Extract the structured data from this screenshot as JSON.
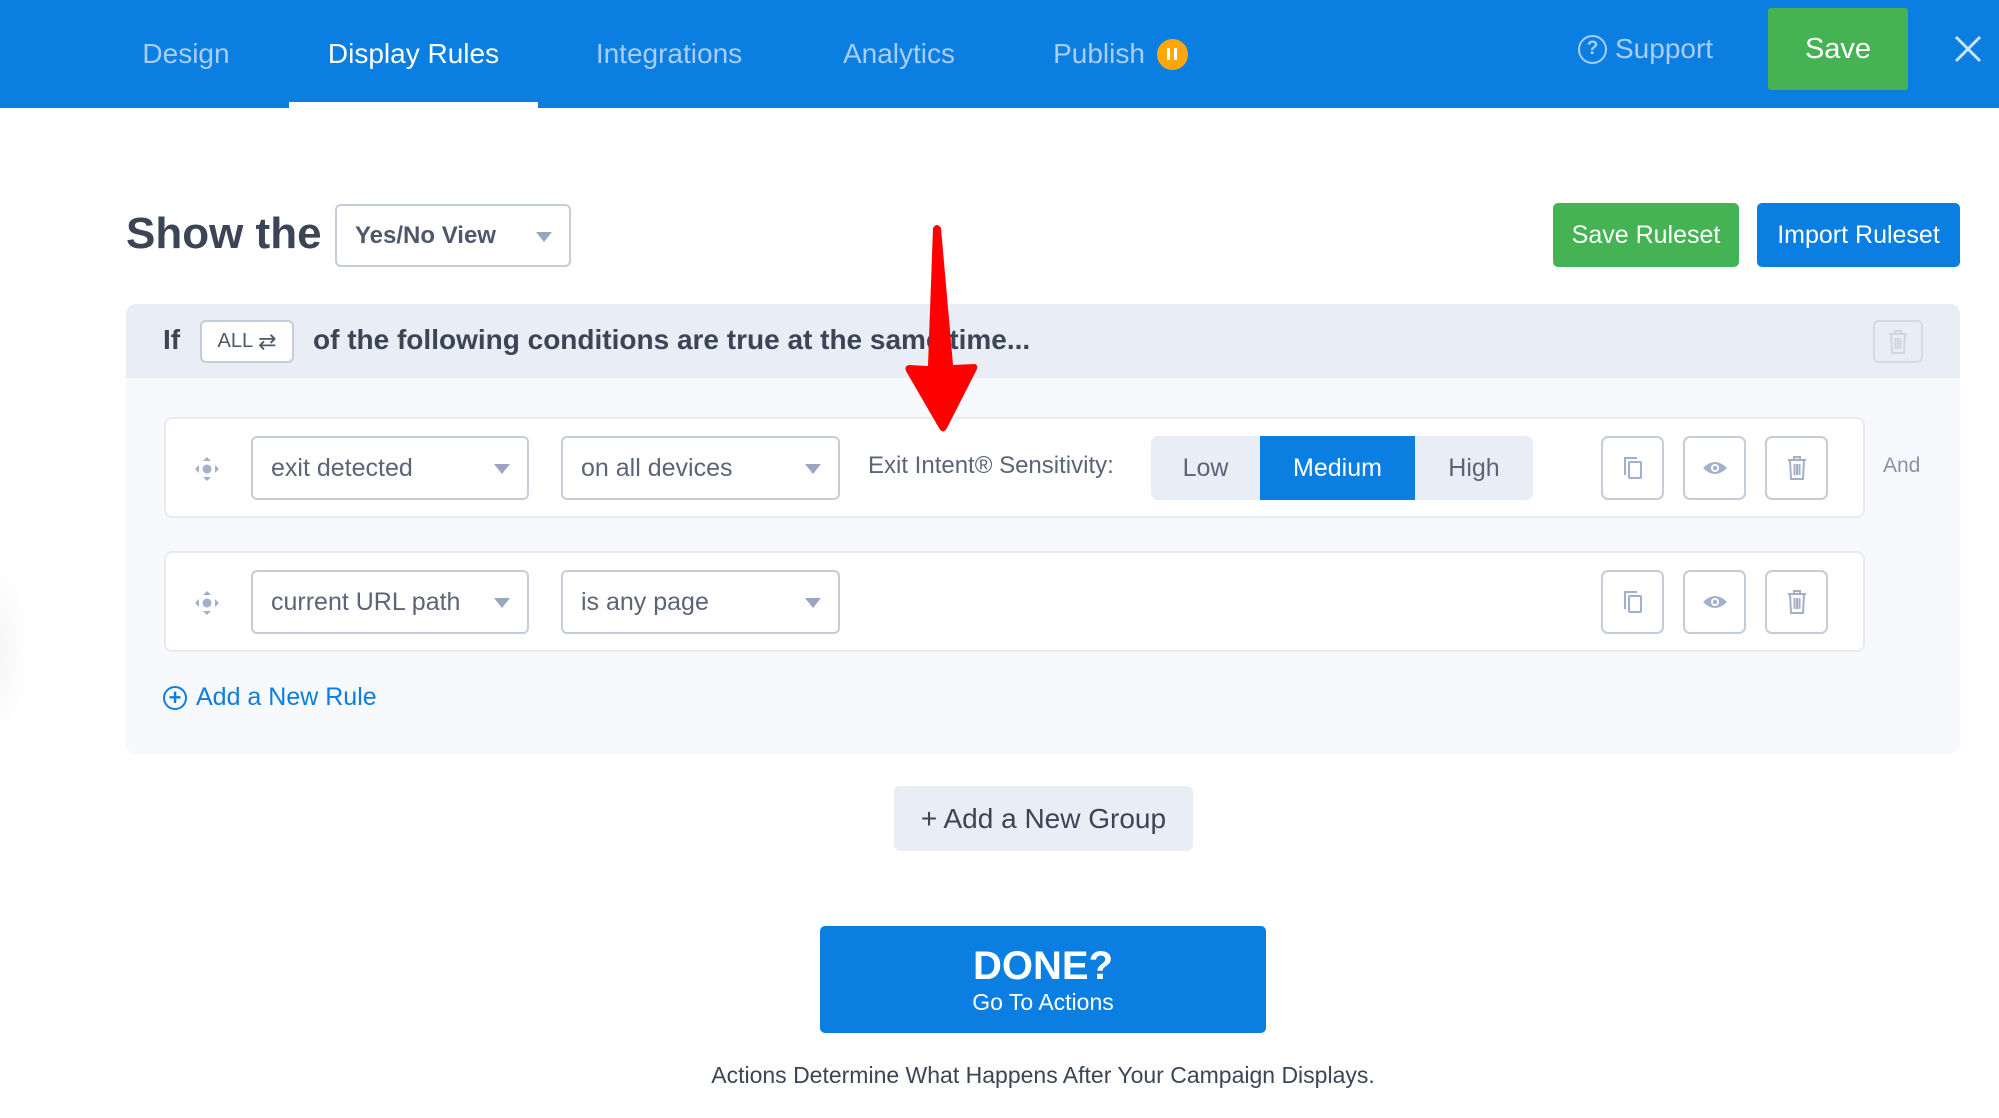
{
  "topbar": {
    "tabs": [
      {
        "label": "Design",
        "active": false
      },
      {
        "label": "Display Rules",
        "active": true
      },
      {
        "label": "Integrations",
        "active": false
      },
      {
        "label": "Analytics",
        "active": false
      },
      {
        "label": "Publish",
        "active": false,
        "badge": "paused-icon"
      }
    ],
    "support_label": "Support",
    "support_icon": "question-circle-icon",
    "save_label": "Save",
    "close_icon": "close-icon",
    "accent_color": "#0b7ee2"
  },
  "header": {
    "title": "Show the",
    "view_select": {
      "value": "Yes/No View"
    },
    "save_ruleset_label": "Save Ruleset",
    "import_ruleset_label": "Import Ruleset"
  },
  "group": {
    "if_label": "If",
    "match_select": "ALL",
    "match_icon": "⇄",
    "condition_text": "of the following conditions are true at the same time...",
    "rules": [
      {
        "trigger": "exit detected",
        "qualifier": "on all devices",
        "sensitivity_label": "Exit Intent® Sensitivity:",
        "sensitivity_options": [
          "Low",
          "Medium",
          "High"
        ],
        "sensitivity_selected": "Medium",
        "connector": "And"
      },
      {
        "trigger": "current URL path",
        "qualifier": "is any page"
      }
    ],
    "add_rule_label": "Add a New Rule"
  },
  "add_group_label": "+ Add a New Group",
  "done": {
    "title": "DONE?",
    "subtitle": "Go To Actions"
  },
  "caption": "Actions Determine What Happens After Your Campaign Displays.",
  "annotation": {
    "type": "red-arrow",
    "color": "#ff0000"
  }
}
